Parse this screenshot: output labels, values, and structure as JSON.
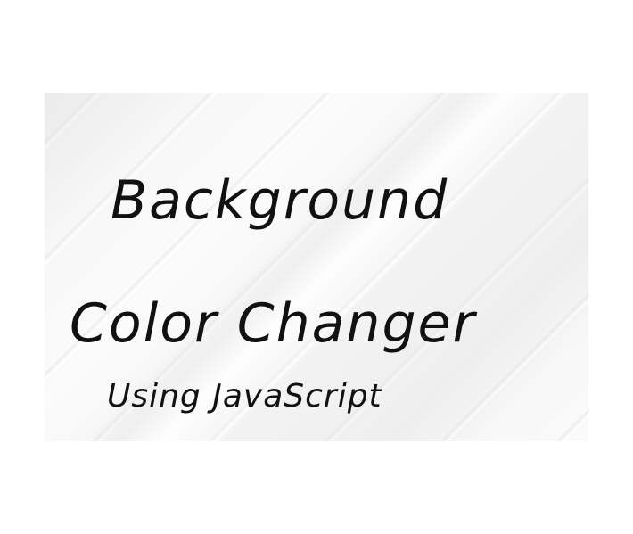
{
  "banner": {
    "title_line1": "Background",
    "title_line2": "Color Changer",
    "subtitle": "Using JavaScript"
  },
  "colors": {
    "page_background": "#ffffff",
    "banner_background": "#f4f4f4",
    "text": "#111111"
  }
}
